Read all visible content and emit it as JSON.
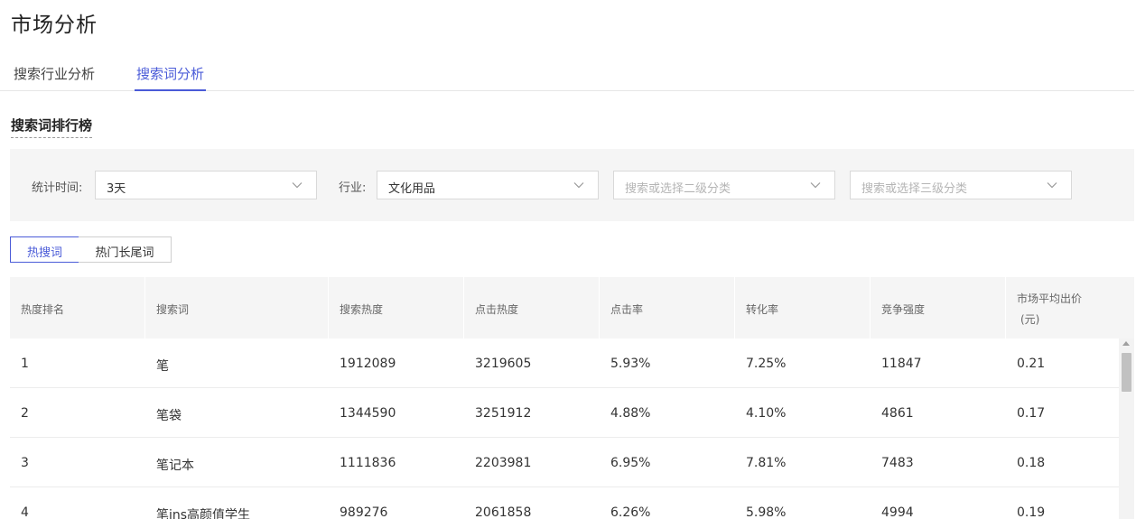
{
  "page": {
    "title": "市场分析"
  },
  "tabs": [
    {
      "label": "搜索行业分析",
      "active": false
    },
    {
      "label": "搜索词分析",
      "active": true
    }
  ],
  "section": {
    "title": "搜索词排行榜"
  },
  "filters": {
    "time": {
      "label": "统计时间:",
      "value": "3天"
    },
    "industry": {
      "label": "行业:",
      "value": "文化用品"
    },
    "level2": {
      "placeholder": "搜索或选择二级分类"
    },
    "level3": {
      "placeholder": "搜索或选择三级分类"
    },
    "chevron_icon": "chevron-down-icon"
  },
  "segments": [
    {
      "label": "热搜词",
      "active": true
    },
    {
      "label": "热门长尾词",
      "active": false
    }
  ],
  "table": {
    "columns": [
      "热度排名",
      "搜索词",
      "搜索热度",
      "点击热度",
      "点击率",
      "转化率",
      "竞争强度",
      "市场平均出价",
      "(元)"
    ],
    "rows": [
      [
        "1",
        "笔",
        "1912089",
        "3219605",
        "5.93%",
        "7.25%",
        "11847",
        "0.21"
      ],
      [
        "2",
        "笔袋",
        "1344590",
        "3251912",
        "4.88%",
        "4.10%",
        "4861",
        "0.17"
      ],
      [
        "3",
        "笔记本",
        "1111836",
        "2203981",
        "6.95%",
        "7.81%",
        "7483",
        "0.18"
      ],
      [
        "4",
        "笔ins高颜值学生",
        "989276",
        "2061858",
        "6.26%",
        "5.98%",
        "4994",
        "0.19"
      ]
    ]
  },
  "colors": {
    "accent": "#4a5bd8",
    "panel_bg": "#f5f5f5",
    "border": "#d9d9d9"
  }
}
